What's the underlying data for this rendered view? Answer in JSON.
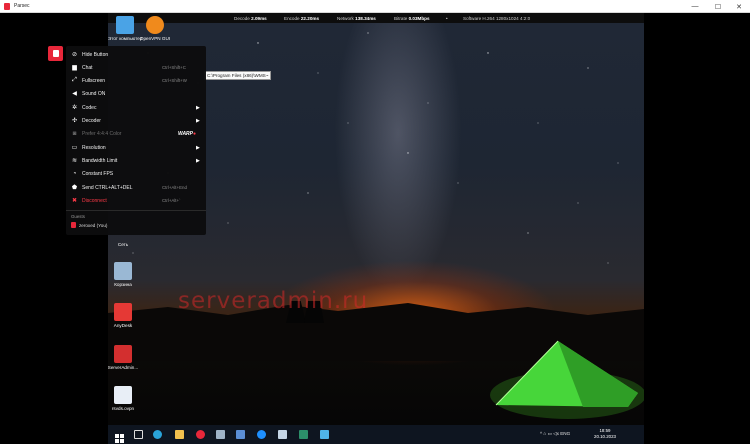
{
  "window": {
    "title": "Parsec",
    "controls": {
      "minimize": "—",
      "maximize": "☐",
      "close": "✕"
    }
  },
  "status_bar": {
    "decode_label": "Decode",
    "decode_value": "2.09ms",
    "encode_label": "Encode",
    "encode_value": "22.20ms",
    "network_label": "Network",
    "network_value": "138.34ms",
    "bitrate_label": "Bitrate",
    "bitrate_value": "0.03Mbps",
    "dot": "•",
    "software": "Software H.264 1280x1024 4:2:0"
  },
  "desktop_icons": [
    {
      "label": "Этот компьютер",
      "color": "#4aa3e6"
    },
    {
      "label": "OpenVPN GUI",
      "color": "#f08a1c"
    },
    {
      "label": "Сеть",
      "color": "#3b7fc6"
    },
    {
      "label": "Корзина",
      "color": "#9ab8d4"
    },
    {
      "label": "AnyDesk",
      "color": "#e53935"
    },
    {
      "label": "ServerAdmin...",
      "color": "#d32f2f"
    },
    {
      "label": "rsvds.ovpn",
      "color": "#e8eef6"
    }
  ],
  "path_tooltip": "C:\\Program Files (x86)\\WMS~",
  "watermark": "serveradmin.ru",
  "menu": {
    "items": [
      {
        "label": "Hide Button",
        "shortcut": "",
        "arrow": "",
        "icon": "eye-slash-icon",
        "glyph": "⊘",
        "state": "normal"
      },
      {
        "label": "Chat",
        "shortcut": "Ctrl+Shift+C",
        "arrow": "",
        "icon": "chat-icon",
        "glyph": "▆",
        "state": "normal"
      },
      {
        "label": "Fullscreen",
        "shortcut": "Ctrl+Shift+W",
        "arrow": "",
        "icon": "fullscreen-icon",
        "glyph": "⤢",
        "state": "normal"
      },
      {
        "label": "Sound ON",
        "shortcut": "",
        "arrow": "",
        "icon": "speaker-icon",
        "glyph": "◀",
        "state": "normal"
      },
      {
        "label": "Codec",
        "shortcut": "",
        "arrow": "▶",
        "icon": "gear-icon",
        "glyph": "✲",
        "state": "normal"
      },
      {
        "label": "Decoder",
        "shortcut": "",
        "arrow": "▶",
        "icon": "decoder-icon",
        "glyph": "✣",
        "state": "normal"
      },
      {
        "label": "Prefer 4:4:4 Color",
        "shortcut": "",
        "arrow": "",
        "icon": "camera-icon",
        "glyph": "◙",
        "state": "disabled"
      },
      {
        "label": "Resolution",
        "shortcut": "",
        "arrow": "▶",
        "icon": "monitor-icon",
        "glyph": "▭",
        "state": "normal"
      },
      {
        "label": "Bandwidth Limit",
        "shortcut": "",
        "arrow": "▶",
        "icon": "wifi-icon",
        "glyph": "≋",
        "state": "normal"
      },
      {
        "label": "Constant FPS",
        "shortcut": "",
        "arrow": "",
        "icon": "clock-icon",
        "glyph": "◔",
        "state": "normal"
      },
      {
        "label": "Send CTRL+ALT+DEL",
        "shortcut": "Ctrl+Alt+End",
        "arrow": "",
        "icon": "shield-icon",
        "glyph": "⬟",
        "state": "normal"
      },
      {
        "label": "Disconnect",
        "shortcut": "Ctrl+Alt+`",
        "arrow": "",
        "icon": "disconnect-icon",
        "glyph": "✖",
        "state": "danger"
      }
    ],
    "warp_badge": {
      "text": "WARP",
      "mark": "●"
    },
    "guests_heading": "Guests",
    "guest_name": "zeroxed (You)"
  },
  "taskbar": {
    "tray_text": "^ ⌂ ▭ ◁x ENG",
    "time": "18:59",
    "date": "20.10.2023"
  },
  "colors": {
    "accent": "#e8273a",
    "menu_bg": "#0c0c0e",
    "tent": "#44d83a"
  }
}
